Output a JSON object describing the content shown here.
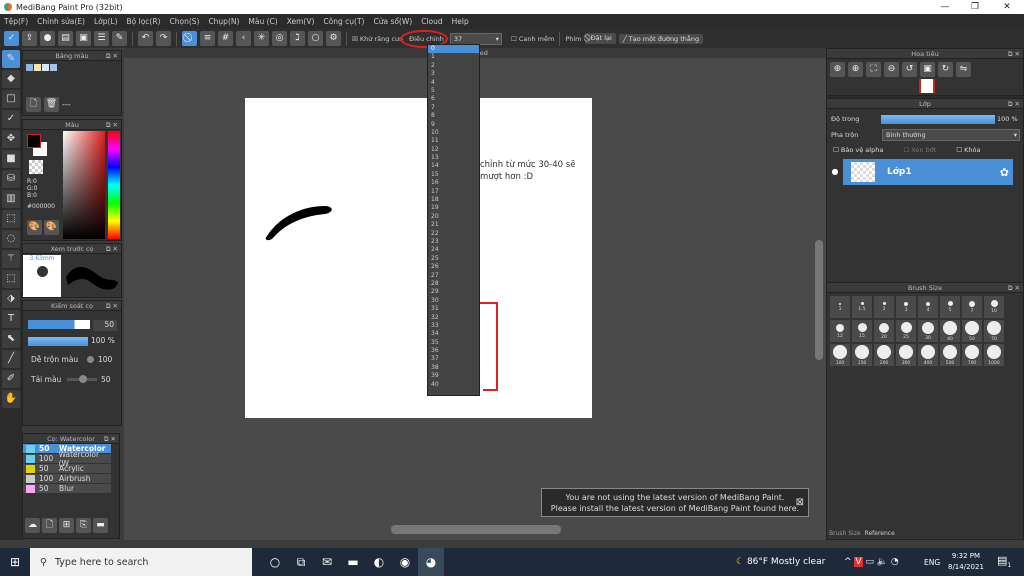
{
  "window": {
    "title": "MediBang Paint Pro (32bit)",
    "min": "—",
    "max": "❐",
    "close": "✕"
  },
  "menu": [
    "Tệp(F)",
    "Chỉnh sửa(E)",
    "Lớp(L)",
    "Bộ lọc(R)",
    "Chọn(S)",
    "Chụp(N)",
    "Màu (C)",
    "Xem(V)",
    "Công cụ(T)",
    "Cửa sổ(W)",
    "Cloud",
    "Help"
  ],
  "toolbar": {
    "antialias": "Khử răng cưa",
    "adjust": "Điều chỉnh",
    "adjust_value": "37",
    "crop": "Canh mềm",
    "key": "Phím",
    "reset": "Đặt lại",
    "straight": "Tạo một đường thẳng"
  },
  "dropdown": {
    "options": [
      "0",
      "1",
      "2",
      "3",
      "4",
      "5",
      "6",
      "7",
      "8",
      "9",
      "10",
      "11",
      "12",
      "13",
      "14",
      "15",
      "16",
      "17",
      "18",
      "19",
      "20",
      "21",
      "22",
      "23",
      "24",
      "25",
      "26",
      "27",
      "28",
      "29",
      "30",
      "31",
      "32",
      "33",
      "34",
      "35",
      "36",
      "37",
      "38",
      "39",
      "40"
    ],
    "selected": "0"
  },
  "canvas": {
    "tab": "Untitled",
    "note_line1": "chỉnh từ mức 30-40 sẽ",
    "note_line2": "mượt hơn :D"
  },
  "palette": {
    "title": "Bảng màu",
    "colors": [
      "#8fb4e0",
      "#f5e6a8",
      "#d8e6f8",
      "#a8c4ec"
    ],
    "dash": "---"
  },
  "color": {
    "title": "Màu",
    "r": "R:0",
    "g": "G:0",
    "b": "B:0",
    "hex": "#000000",
    "primary": "#000000",
    "secondary": "#ffffff"
  },
  "preview": {
    "title": "Xem trước cọ",
    "size": "3.63mm"
  },
  "brush_control": {
    "title": "Kiểm soát cọ",
    "size": "50",
    "opacity": "100 %",
    "blend_label": "Dễ trộn màu",
    "blend": "100",
    "reload_label": "Tải màu",
    "reload": "50"
  },
  "brushes": {
    "title": "Cọ: Watercolor",
    "items": [
      {
        "size": "50",
        "name": "Watercolor",
        "color": "#6ad0f0"
      },
      {
        "size": "100",
        "name": "Watercolor (W",
        "color": "#6ad0f0"
      },
      {
        "size": "50",
        "name": "Acrylic",
        "color": "#e8d000"
      },
      {
        "size": "100",
        "name": "Airbrush",
        "color": "#cccccc"
      },
      {
        "size": "50",
        "name": "Blur",
        "color": "#f8a8f0"
      }
    ]
  },
  "navigator": {
    "title": "Hoa tiêu"
  },
  "layer": {
    "title": "Lớp",
    "opacity_label": "Độ trong",
    "opacity": "100 %",
    "blend_label": "Pha trộn",
    "blend": "Bình thường",
    "protect_alpha": "Bảo vệ alpha",
    "clipping": "Xén bớt",
    "lock": "Khóa",
    "layer_name": "Lớp1"
  },
  "brush_size": {
    "title": "Brush Size",
    "sizes": [
      "1",
      "1.5",
      "2",
      "3",
      "4",
      "5",
      "7",
      "10",
      "12",
      "15",
      "20",
      "25",
      "30",
      "40",
      "50",
      "70",
      "100",
      "150",
      "200",
      "300",
      "400",
      "500",
      "700",
      "1000"
    ],
    "tabs": [
      "Brush Size",
      "Reference"
    ]
  },
  "notice": {
    "line1": "You are not using the latest version of MediBang Paint.",
    "line2": "Please install the latest version of MediBang Paint found here.",
    "close": "⊠"
  },
  "taskbar": {
    "search": "Type here to search",
    "weather": "86°F  Mostly clear",
    "lang": "ENG",
    "time": "9:32 PM",
    "date": "8/14/2021",
    "notif": "1"
  },
  "colors": {
    "accent": "#4a90d9",
    "annotation": "#e02020"
  }
}
